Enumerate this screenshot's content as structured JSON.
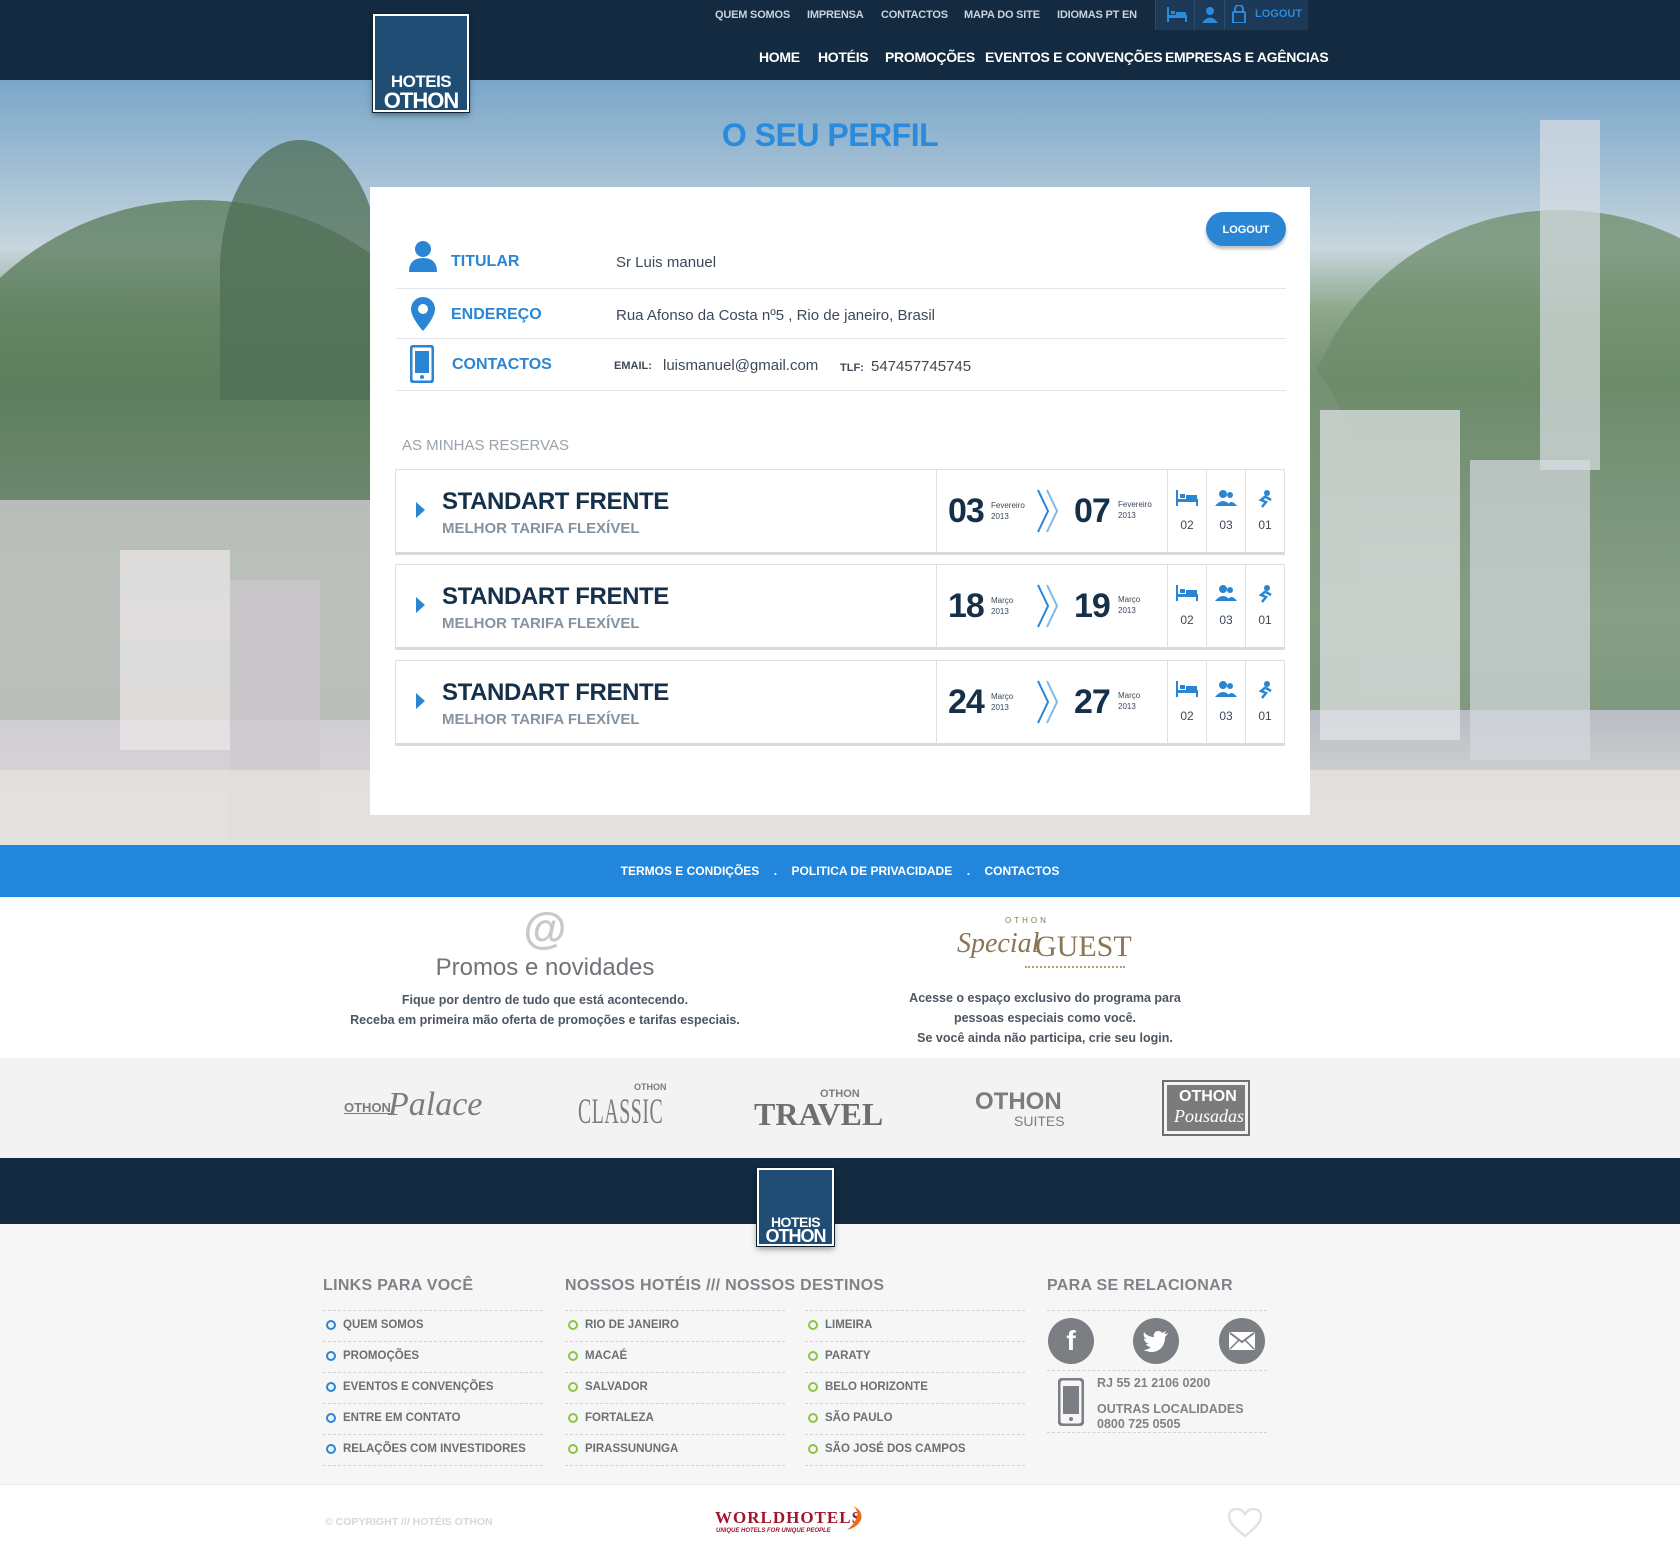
{
  "header": {
    "logo_line1": "HOTEIS",
    "logo_line2": "OTHON",
    "top_links": [
      "QUEM SOMOS",
      "IMPRENSA",
      "CONTACTOS",
      "MAPA DO SITE",
      "IDIOMAS PT EN"
    ],
    "logout_label": "LOGOUT",
    "main_nav": [
      "HOME",
      "HOTÉIS",
      "PROMOÇÕES",
      "EVENTOS E CONVENÇÕES",
      "EMPRESAS E AGÊNCIAS"
    ]
  },
  "page_title": "O SEU PERFIL",
  "profile": {
    "logout_button": "LOGOUT",
    "titular_label": "TITULAR",
    "titular_value": "Sr Luis manuel",
    "endereco_label": "ENDEREÇO",
    "endereco_value": "Rua Afonso da Costa nº5 , Rio de janeiro, Brasil",
    "contactos_label": "CONTACTOS",
    "email_label": "EMAIL:",
    "email_value": "luismanuel@gmail.com",
    "tlf_label": "TLF:",
    "tlf_value": "547457745745"
  },
  "reservations": {
    "heading": "AS MINHAS RESERVAS",
    "items": [
      {
        "room": "STANDART FRENTE",
        "rate": "MELHOR TARIFA FLEXÍVEL",
        "in_day": "03",
        "in_month": "Fevereiro",
        "in_year": "2013",
        "out_day": "07",
        "out_month": "Fevereiro",
        "out_year": "2013",
        "rooms": "02",
        "adults": "03",
        "children": "01"
      },
      {
        "room": "STANDART FRENTE",
        "rate": "MELHOR TARIFA FLEXÍVEL",
        "in_day": "18",
        "in_month": "Março",
        "in_year": "2013",
        "out_day": "19",
        "out_month": "Março",
        "out_year": "2013",
        "rooms": "02",
        "adults": "03",
        "children": "01"
      },
      {
        "room": "STANDART FRENTE",
        "rate": "MELHOR TARIFA FLEXÍVEL",
        "in_day": "24",
        "in_month": "Março",
        "in_year": "2013",
        "out_day": "27",
        "out_month": "Março",
        "out_year": "2013",
        "rooms": "02",
        "adults": "03",
        "children": "01"
      }
    ]
  },
  "footer_bar": {
    "links": [
      "TERMOS E CONDIÇÕES",
      "POLITICA DE PRIVACIDADE",
      "CONTACTOS"
    ],
    "separator": "."
  },
  "promo": {
    "at_symbol": "@",
    "title": "Promos e novidades",
    "line1": "Fique por dentro de tudo que está acontecendo.",
    "line2": "Receba em primeira mão oferta de promoções e tarifas especiais."
  },
  "special_guest": {
    "small": "OTHON",
    "script": "Special",
    "guest": "GUEST",
    "line1": "Acesse o espaço exclusivo do programa para",
    "line2": "pessoas especiais como você.",
    "line3": "Se você ainda não participa, crie seu login."
  },
  "brands": {
    "palace_a": "OTHON",
    "palace_b": "Palace",
    "classic_a": "OTHON",
    "classic_b": "CLASSIC",
    "travel_a": "OTHON",
    "travel_b": "TRAVEL",
    "suites_a": "OTHON",
    "suites_b": "SUITES",
    "pousadas_a": "OTHON",
    "pousadas_b": "Pousadas"
  },
  "footer": {
    "links_heading": "LINKS PARA VOCÊ",
    "links": [
      "QUEM SOMOS",
      "PROMOÇÕES",
      "EVENTOS E CONVENÇÕES",
      "ENTRE EM CONTATO",
      "RELAÇÕES COM INVESTIDORES"
    ],
    "hotels_heading": "NOSSOS HOTÉIS /// NOSSOS DESTINOS",
    "destinations_col1": [
      "RIO DE JANEIRO",
      "MACAÉ",
      "SALVADOR",
      "FORTALEZA",
      "PIRASSUNUNGA"
    ],
    "destinations_col2": [
      "LIMEIRA",
      "PARATY",
      "BELO HORIZONTE",
      "SÃO PAULO",
      "SÃO JOSÉ DOS CAMPOS"
    ],
    "relate_heading": "PARA SE RELACIONAR",
    "phone_rj": "RJ 55 21 2106 0200",
    "other_label": "OUTRAS LOCALIDADES",
    "other_phone": "0800 725 0505"
  },
  "bottom": {
    "copyright": "© COPYRIGHT /// HOTÉIS OTHON",
    "worldhotels": "WORLDHOTELS",
    "worldhotels_tag": "UNIQUE HOTELS FOR UNIQUE PEOPLE"
  },
  "colors": {
    "navy": "#132a40",
    "accent_blue": "#2287dc",
    "link_blue": "#2a86d4",
    "green": "#8cc63f"
  }
}
